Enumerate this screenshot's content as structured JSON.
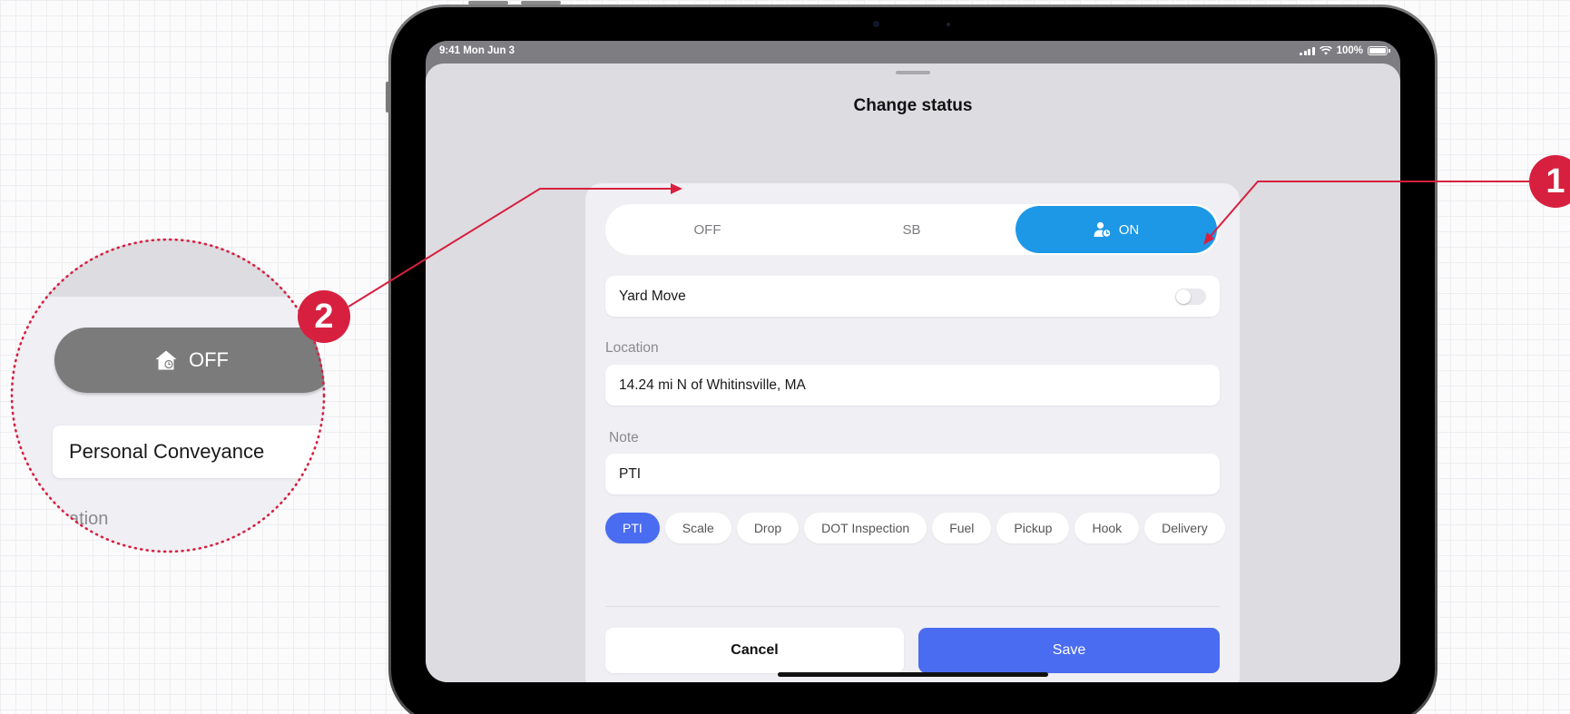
{
  "statusbar": {
    "time": "9:41 Mon Jun 3",
    "battery": "100%"
  },
  "sheet": {
    "title": "Change status"
  },
  "segments": {
    "off": "OFF",
    "sb": "SB",
    "on": "ON",
    "selected": "ON"
  },
  "yard_move": {
    "label": "Yard Move",
    "enabled": false
  },
  "location": {
    "label": "Location",
    "value": "14.24 mi N of Whitinsville, MA"
  },
  "note": {
    "label": "Note",
    "value": "PTI"
  },
  "chips": [
    {
      "label": "PTI",
      "selected": true
    },
    {
      "label": "Scale",
      "selected": false
    },
    {
      "label": "Drop",
      "selected": false
    },
    {
      "label": "DOT Inspection",
      "selected": false
    },
    {
      "label": "Fuel",
      "selected": false
    },
    {
      "label": "Pickup",
      "selected": false
    },
    {
      "label": "Hook",
      "selected": false
    },
    {
      "label": "Delivery",
      "selected": false
    }
  ],
  "actions": {
    "cancel": "Cancel",
    "save": "Save"
  },
  "callouts": {
    "one": "1",
    "two": "2"
  },
  "magnifier": {
    "off_label": "OFF",
    "mode_label": "Personal Conveyance",
    "partial_label": "ation"
  },
  "colors": {
    "accent_blue": "#1d98e7",
    "primary_button": "#4a6cf0",
    "callout_red": "#d7203f",
    "off_selected_gray": "#7b7b7b"
  }
}
